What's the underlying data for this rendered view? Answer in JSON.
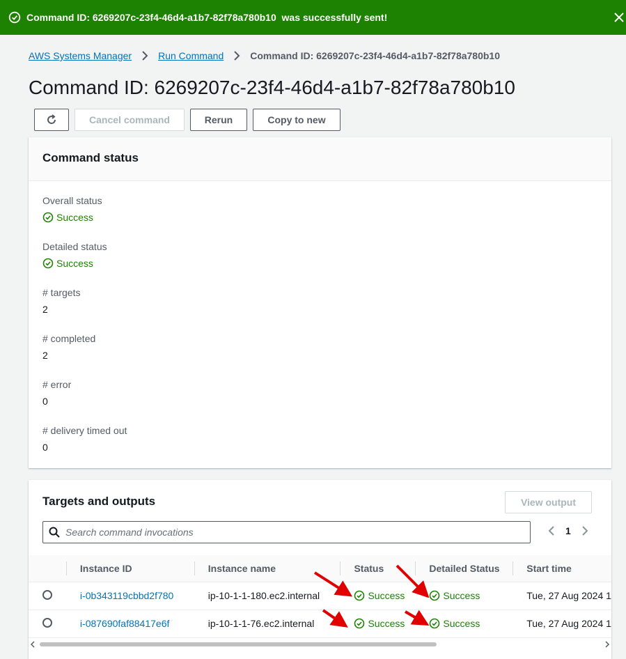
{
  "flash": {
    "message": "Command ID: 6269207c-23f4-46d4-a1b7-82f78a780b10  was successfully sent!",
    "ok_icon": "check-circle-icon",
    "close_icon": "close-icon"
  },
  "breadcrumb": {
    "items": [
      "AWS Systems Manager",
      "Run Command"
    ],
    "current": "Command ID: 6269207c-23f4-46d4-a1b7-82f78a780b10"
  },
  "page_title": "Command ID: 6269207c-23f4-46d4-a1b7-82f78a780b10",
  "actions": {
    "refresh_icon": "refresh-icon",
    "cancel": "Cancel command",
    "rerun": "Rerun",
    "copy_to_new": "Copy to new"
  },
  "command_status": {
    "title": "Command status",
    "overall_label": "Overall status",
    "overall_value": "Success",
    "detailed_label": "Detailed status",
    "detailed_value": "Success",
    "targets_label": "# targets",
    "targets_value": "2",
    "completed_label": "# completed",
    "completed_value": "2",
    "error_label": "# error",
    "error_value": "0",
    "timed_out_label": "# delivery timed out",
    "timed_out_value": "0"
  },
  "targets": {
    "title": "Targets and outputs",
    "view_output": "View output",
    "search_placeholder": "Search command invocations",
    "page": "1",
    "columns": [
      "Instance ID",
      "Instance name",
      "Status",
      "Detailed Status",
      "Start time"
    ],
    "rows": [
      {
        "id": "i-0b343119cbbd2f780",
        "name": "ip-10-1-1-180.ec2.internal",
        "status": "Success",
        "detailed": "Success",
        "start": "Tue, 27 Aug 2024 1"
      },
      {
        "id": "i-087690faf88417e6f",
        "name": "ip-10-1-1-76.ec2.internal",
        "status": "Success",
        "detailed": "Success",
        "start": "Tue, 27 Aug 2024 1"
      }
    ]
  },
  "colors": {
    "success": "#1d8102",
    "link": "#0073bb",
    "annotation_arrow": "#e00000"
  }
}
